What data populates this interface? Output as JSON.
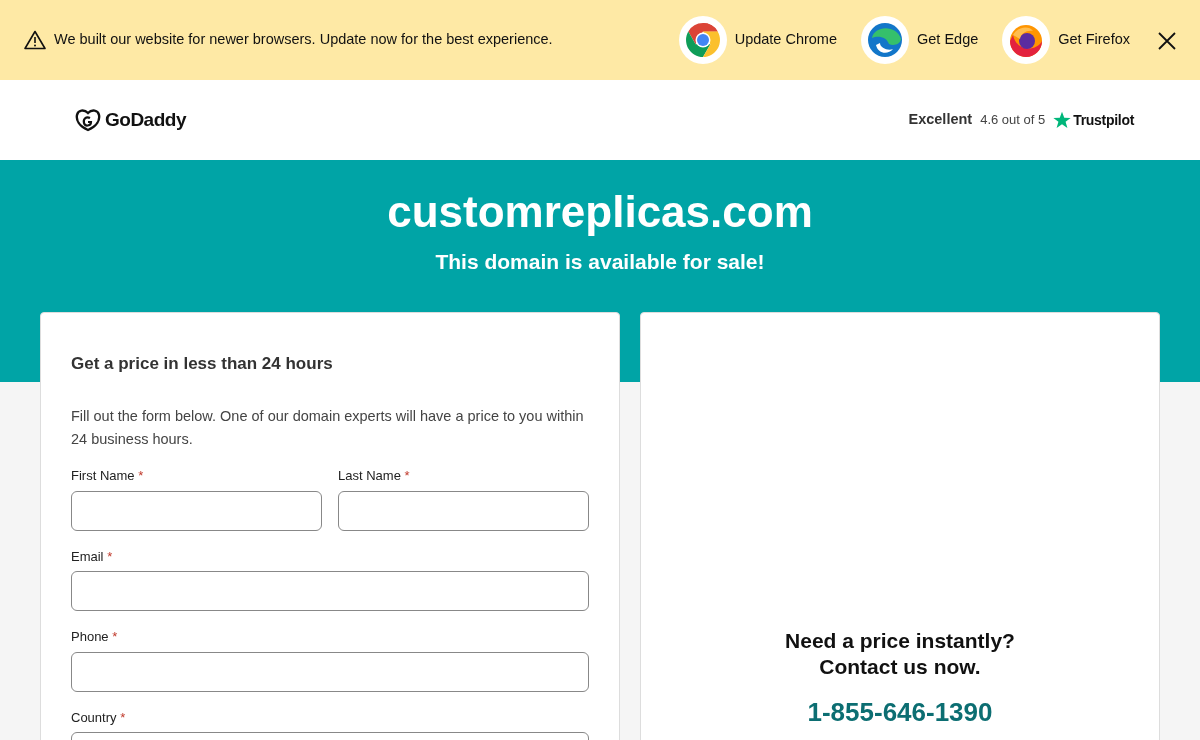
{
  "banner": {
    "message": "We built our website for newer browsers. Update now for the best experience.",
    "browsers": [
      {
        "kind": "chrome",
        "label": "Update Chrome"
      },
      {
        "kind": "edge",
        "label": "Get Edge"
      },
      {
        "kind": "firefox",
        "label": "Get Firefox"
      }
    ]
  },
  "header": {
    "logo": "GoDaddy",
    "rating_word": "Excellent",
    "rating": "4.6 out of 5",
    "rating_brand": "Trustpilot"
  },
  "hero": {
    "domain": "customreplicas.com",
    "subtitle": "This domain is available for sale!"
  },
  "form": {
    "title": "Get a price in less than 24 hours",
    "intro": "Fill out the form below. One of our domain experts will have a price to you within 24 business hours.",
    "fields": [
      {
        "label": "First Name",
        "required_mark": "*",
        "half": true
      },
      {
        "label": "Last Name",
        "required_mark": "*",
        "half": true
      },
      {
        "label": "Email",
        "required_mark": "*",
        "half": false
      },
      {
        "label": "Phone",
        "required_mark": "*",
        "half": false
      },
      {
        "label": "Country",
        "required_mark": "*",
        "half": false
      }
    ]
  },
  "contact": {
    "heading_1": "Need a price instantly?",
    "heading_2": "Contact us now.",
    "phone": "1-855-646-1390"
  }
}
